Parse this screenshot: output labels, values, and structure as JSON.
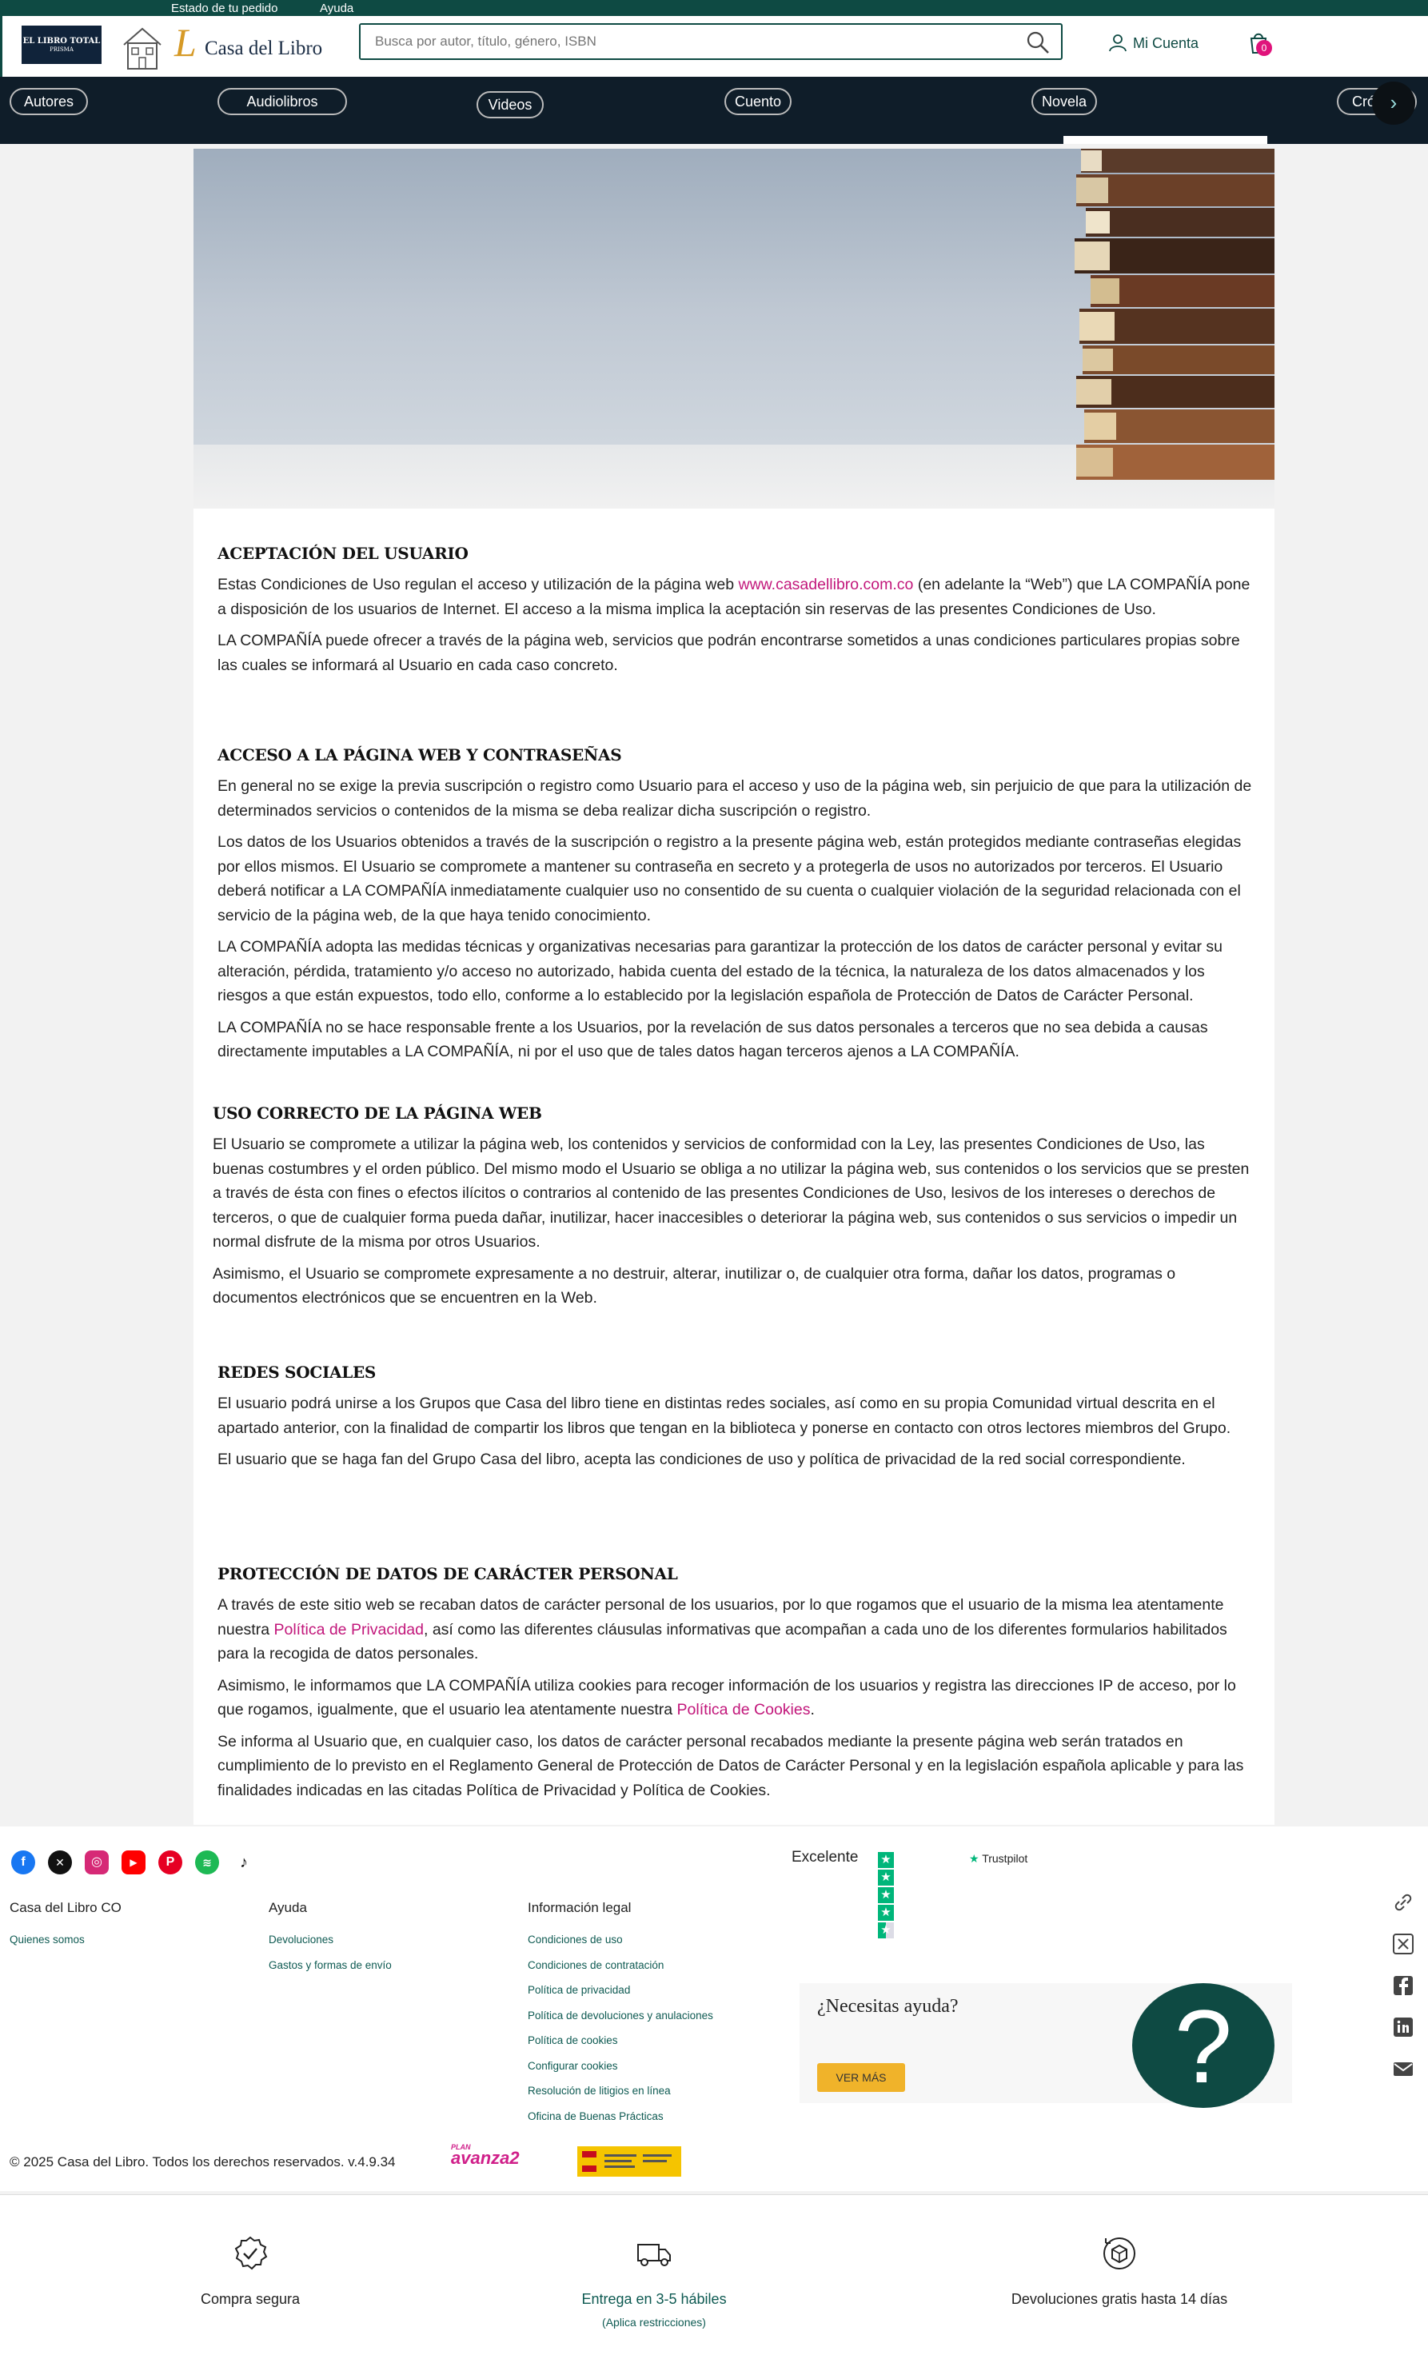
{
  "topbar": {
    "order_status": "Estado de tu pedido",
    "help": "Ayuda"
  },
  "header": {
    "logo_total": {
      "line1": "EL LIBRO TOTAL",
      "line2": "PRISMA"
    },
    "brand_name": "Casa del Libro",
    "search_placeholder": "Busca por autor, título, género, ISBN",
    "account_label": "Mi Cuenta",
    "cart_count": "0"
  },
  "nav": {
    "items": [
      {
        "label": "Autores"
      },
      {
        "label": "Audiolibros"
      },
      {
        "label": "Videos"
      },
      {
        "label": "Cuento"
      },
      {
        "label": "Novela"
      },
      {
        "label": "Crónica"
      }
    ]
  },
  "sections": [
    {
      "title": "ACEPTACIÓN DEL USUARIO",
      "p1_before": "Estas Condiciones de Uso regulan el acceso y utilización de la página web ",
      "p1_link": "www.casadellibro.com.co",
      "p1_after": " (en adelante la “Web”) que LA COMPAÑÍA pone a disposición de los usuarios de Internet. El acceso a la misma implica la aceptación sin reservas de las presentes Condiciones de Uso.",
      "p2": "LA COMPAÑÍA puede ofrecer a través de la página web, servicios que podrán encontrarse sometidos a unas condiciones particulares propias sobre las cuales se informará al Usuario en cada caso concreto."
    },
    {
      "title": "ACCESO A LA PÁGINA WEB Y CONTRASEÑAS",
      "paragraphs": [
        "En general no se exige la previa suscripción o registro como Usuario para el acceso y uso de la página web, sin perjuicio de que para la utilización de determinados servicios o contenidos de la misma se deba realizar dicha suscripción o registro.",
        "Los datos de los Usuarios obtenidos a través de la suscripción o registro a la presente página web, están protegidos mediante contraseñas elegidas por ellos mismos. El Usuario se compromete a mantener su contraseña en secreto y a protegerla de usos no autorizados por terceros. El Usuario deberá notificar a LA COMPAÑÍA inmediatamente cualquier uso no consentido de su cuenta o cualquier violación de la seguridad relacionada con el servicio de la página web, de la que haya tenido conocimiento.",
        "LA COMPAÑÍA adopta las medidas técnicas y organizativas necesarias para garantizar la protección de los datos de carácter personal y evitar su alteración, pérdida, tratamiento y/o acceso no autorizado, habida cuenta del estado de la técnica, la naturaleza de los datos almacenados y los riesgos a que están expuestos, todo ello, conforme a lo establecido por la legislación española de Protección de Datos de Carácter Personal.",
        "LA COMPAÑÍA no se hace responsable frente a los Usuarios, por la revelación de sus datos personales a terceros que no sea debida a causas directamente imputables a LA COMPAÑÍA, ni por el uso que de tales datos hagan terceros ajenos a LA COMPAÑÍA."
      ]
    },
    {
      "title": "USO CORRECTO DE LA PÁGINA WEB",
      "paragraphs": [
        "El Usuario se compromete a utilizar la página web, los contenidos y servicios de conformidad con la Ley, las presentes Condiciones de Uso, las buenas costumbres y el orden público. Del mismo modo el Usuario se obliga a no utilizar la página web, sus contenidos o los servicios que se presten a través de ésta con fines o efectos ilícitos o contrarios al contenido de las presentes Condiciones de Uso, lesivos de los intereses o derechos de terceros, o que de cualquier forma pueda dañar, inutilizar, hacer inaccesibles o deteriorar la página web, sus contenidos o sus servicios o impedir un normal disfrute de la misma por otros Usuarios.",
        "Asimismo, el Usuario se compromete expresamente a no destruir, alterar, inutilizar o, de cualquier otra forma, dañar los datos, programas o documentos electrónicos que se encuentren en la Web."
      ]
    },
    {
      "title": "REDES SOCIALES",
      "paragraphs": [
        "El usuario podrá unirse a los Grupos que Casa del libro tiene en distintas redes sociales, así como en su propia Comunidad virtual descrita en el apartado anterior, con la finalidad de compartir los libros que tengan en la biblioteca y ponerse en contacto con otros lectores miembros del Grupo.",
        "El usuario que se haga fan del Grupo Casa del libro, acepta las condiciones de uso y política de privacidad de la red social correspondiente."
      ]
    },
    {
      "title": "PROTECCIÓN DE DATOS DE CARÁCTER PERSONAL",
      "p1_before": "A través de este sitio web se recaban datos de carácter personal de los usuarios, por lo que rogamos que el usuario de la misma lea atentamente nuestra ",
      "p1_link": "Política de Privacidad",
      "p1_after": ", así como las diferentes cláusulas informativas que acompañan a cada uno de los diferentes formularios habilitados para la recogida de datos personales.",
      "p2_before": "Asimismo, le informamos que LA COMPAÑÍA utiliza cookies para recoger información de los usuarios y registra las direcciones IP de acceso, por lo que rogamos, igualmente, que el usuario lea atentamente nuestra ",
      "p2_link": "Política de Cookies",
      "p2_after": ".",
      "p3": "Se informa al Usuario que, en cualquier caso, los datos de carácter personal recabados mediante la presente página web serán tratados en cumplimiento de lo previsto en el Reglamento General de Protección de Datos de Carácter Personal y en la legislación española aplicable y para las finalidades indicadas en las citadas Política de Privacidad y Política de Cookies."
    }
  ],
  "footer": {
    "trustpilot": {
      "rating_text": "Excelente",
      "brand": "Trustpilot"
    },
    "columns": [
      {
        "title": "Casa del Libro CO",
        "links": [
          "Quienes somos"
        ]
      },
      {
        "title": "Ayuda",
        "links": [
          "Devoluciones",
          "Gastos y formas de envío"
        ]
      },
      {
        "title": "Información legal",
        "links": [
          "Condiciones de uso",
          "Condiciones de contratación",
          "Política de privacidad",
          "Política de devoluciones y anulaciones",
          "Política de cookies",
          "Configurar cookies",
          "Resolución de litigios en línea",
          "Oficina de Buenas Prácticas"
        ]
      }
    ],
    "help_box": {
      "title": "¿Necesitas ayuda?",
      "button": "VER MÁS",
      "icon_glyph": "?"
    },
    "copyright": "© 2025 Casa del Libro. Todos los derechos reservados. v.4.9.34",
    "avanza": {
      "small": "PLAN",
      "big": "avanza2"
    }
  },
  "benefits": [
    {
      "label": "Compra segura",
      "sub": "",
      "icon": "shield-check-icon"
    },
    {
      "label": "Entrega en 3-5 hábiles",
      "sub": "(Aplica restricciones)",
      "icon": "truck-icon"
    },
    {
      "label": "Devoluciones gratis hasta 14 días",
      "sub": "",
      "icon": "return-box-icon"
    }
  ],
  "colors": {
    "brand_green": "#0e4a43",
    "link_pink": "#c2177b",
    "nav_dark": "#0f1d29",
    "cta_yellow": "#f0b32a"
  }
}
